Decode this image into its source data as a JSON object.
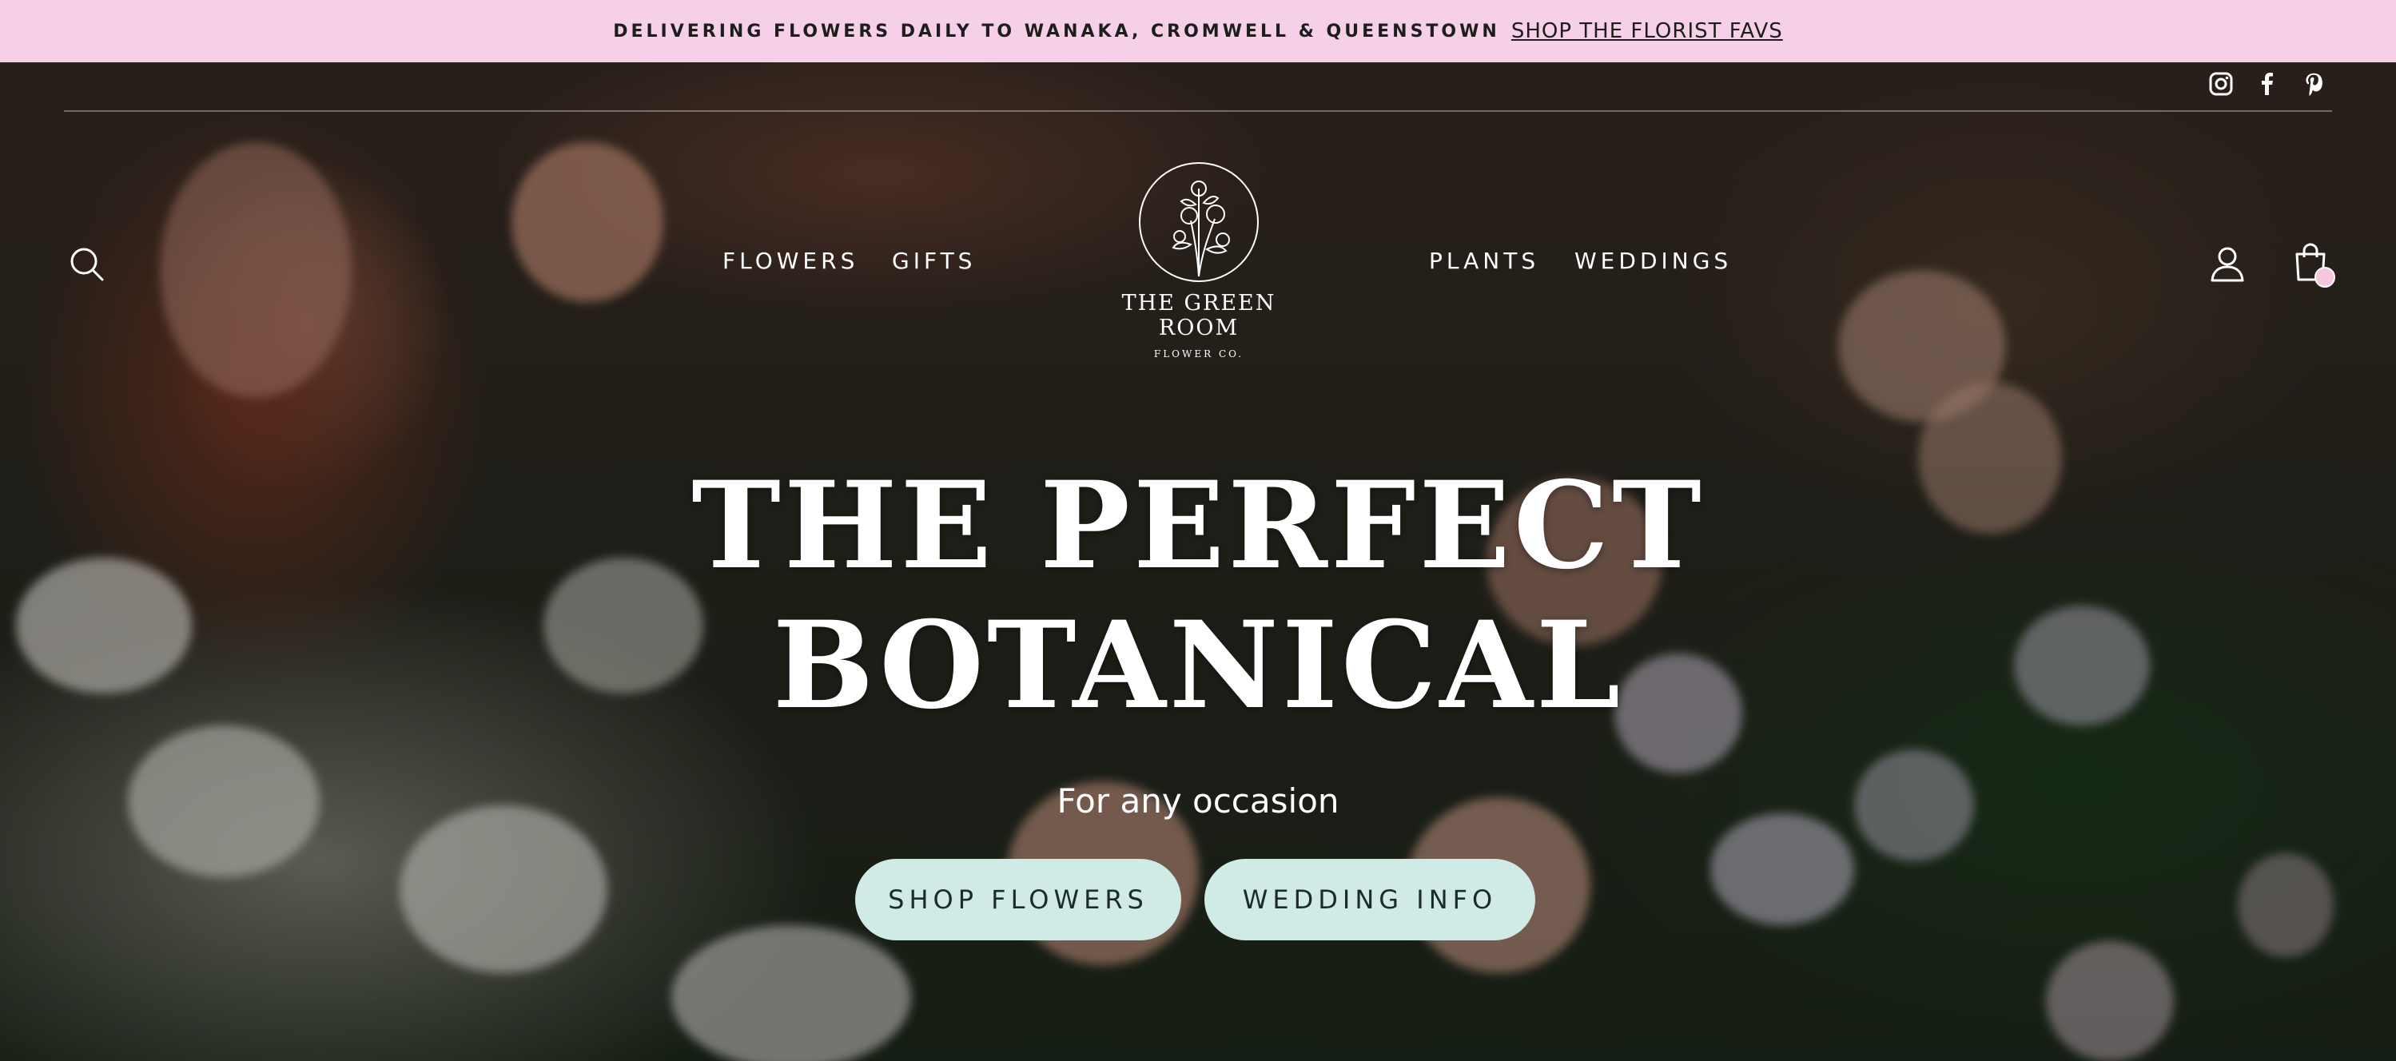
{
  "announcement": {
    "message": "DELIVERING FLOWERS DAILY TO WANAKA, CROMWELL & QUEENSTOWN",
    "link": "SHOP THE FLORIST FAVS"
  },
  "social": [
    "instagram-icon",
    "facebook-icon",
    "pinterest-icon"
  ],
  "nav": {
    "left": [
      "FLOWERS",
      "GIFTS"
    ],
    "right": [
      "PLANTS",
      "WEDDINGS"
    ]
  },
  "logo": {
    "name": "THE GREEN ROOM",
    "sub": "FLOWER CO."
  },
  "hero": {
    "headline_line1": "THE PERFECT",
    "headline_line2": "BOTANICAL",
    "tagline": "For any occasion",
    "cta_primary": "SHOP FLOWERS",
    "cta_secondary": "WEDDING INFO"
  },
  "colors": {
    "announcement_bg": "#f5d0e6",
    "button_bg": "#d0ebe5",
    "cart_badge": "#f5c6de"
  }
}
